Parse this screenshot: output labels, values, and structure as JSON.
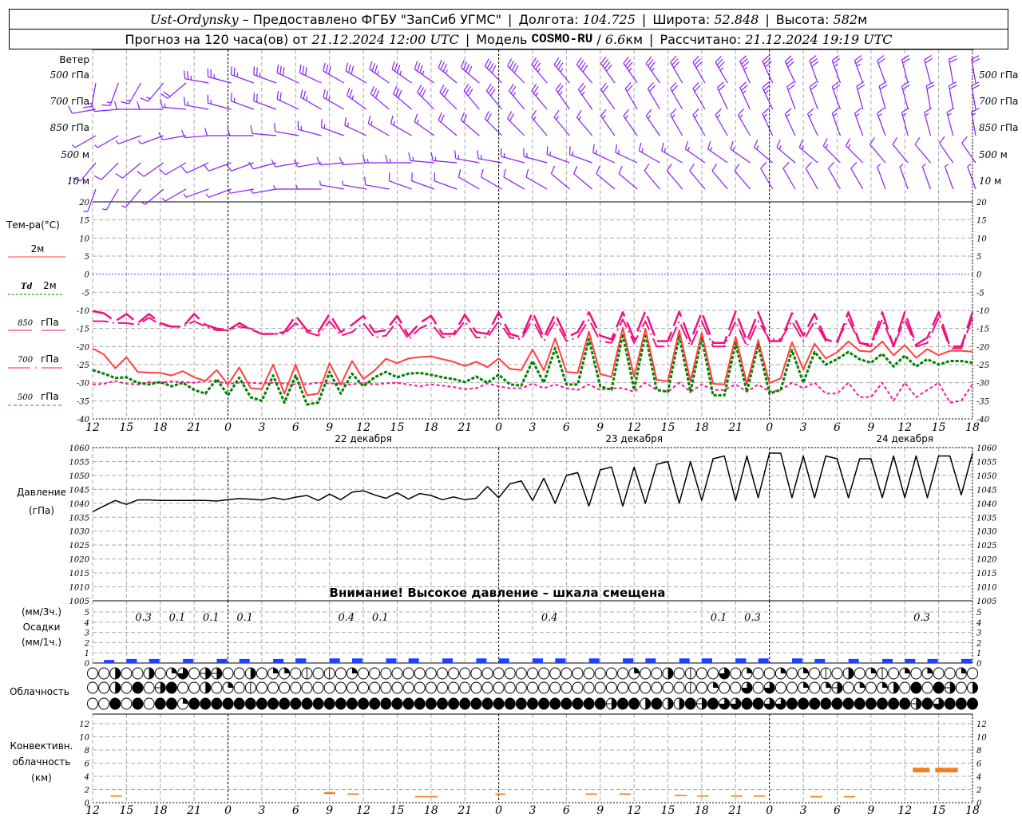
{
  "header": {
    "station": "Ust-Ordynsky",
    "provider": " – Предоставлено ФГБУ \"ЗапСиб УГМС\"",
    "sep": "|",
    "lon_label": "Долгота: ",
    "lon": "104.725",
    "lat_label": "Широта: ",
    "lat": "52.848",
    "alt_label": "Высота: ",
    "alt": "582",
    "alt_unit": "м",
    "forecast_label": "Прогноз на 120 часа(ов) от ",
    "forecast_start": "21.12.2024 12:00 UTC",
    "model_label": "Модель ",
    "model": "COSMO-RU",
    "model_sep": " / ",
    "resolution": "6.6",
    "resolution_unit": "км",
    "computed_label": "Рассчитано: ",
    "computed": "21.12.2024 19:19 UTC"
  },
  "colors": {
    "wind": "#8a1cf0",
    "t2m": "#ff4040",
    "td2m": "#008000",
    "t850": "#f0107f",
    "t700": "#f0107f",
    "t500": "#ff1493",
    "zero_line": "#3050ff",
    "precip": "#2040ff",
    "convective": "#f08020"
  },
  "x_axis": {
    "hour_labels": [
      "12",
      "15",
      "18",
      "21",
      "0",
      "3",
      "6",
      "9",
      "12",
      "15",
      "18",
      "21",
      "0",
      "3",
      "6",
      "9",
      "12",
      "15",
      "18",
      "21",
      "0",
      "3",
      "6",
      "9",
      "12",
      "15",
      "18"
    ],
    "dates": [
      "22 декабря",
      "23 декабря",
      "24 декабря"
    ]
  },
  "wind": {
    "title": "Ветер",
    "levels": [
      {
        "num": "500",
        "unit": " гПа",
        "dir": [
          190,
          200,
          210,
          220,
          230,
          280,
          285,
          290,
          290,
          295,
          295,
          300,
          300,
          305,
          305,
          305,
          310,
          310,
          315,
          315,
          320,
          320,
          320,
          325,
          325,
          325,
          330,
          330,
          330,
          335,
          335,
          335,
          340,
          340,
          340,
          340,
          345,
          345,
          350,
          350
        ],
        "speed": [
          15,
          15,
          15,
          15,
          20,
          25,
          25,
          25,
          25,
          30,
          30,
          30,
          30,
          35,
          35,
          35,
          35,
          40,
          40,
          40,
          35,
          35,
          40,
          40,
          35,
          35,
          30,
          30,
          35,
          35,
          30,
          30,
          30,
          25,
          25,
          20,
          20,
          20,
          20,
          20
        ]
      },
      {
        "num": "700",
        "unit": " гПа",
        "dir": [
          260,
          265,
          270,
          270,
          275,
          280,
          285,
          290,
          290,
          295,
          300,
          300,
          305,
          310,
          310,
          315,
          315,
          320,
          320,
          320,
          320,
          325,
          325,
          325,
          330,
          330,
          330,
          330,
          335,
          335,
          335,
          340,
          340,
          340,
          345,
          345,
          345,
          350,
          350,
          350
        ],
        "speed": [
          10,
          10,
          10,
          10,
          15,
          15,
          15,
          15,
          20,
          20,
          25,
          25,
          25,
          30,
          30,
          30,
          30,
          30,
          30,
          25,
          25,
          25,
          25,
          20,
          20,
          20,
          20,
          20,
          20,
          25,
          25,
          20,
          20,
          20,
          20,
          20,
          20,
          20,
          20,
          20
        ]
      },
      {
        "num": "850",
        "unit": " гПа",
        "dir": [
          240,
          240,
          250,
          250,
          260,
          265,
          270,
          270,
          275,
          280,
          285,
          290,
          295,
          300,
          300,
          305,
          310,
          310,
          315,
          315,
          320,
          320,
          320,
          325,
          325,
          325,
          330,
          330,
          330,
          330,
          335,
          335,
          335,
          340,
          340,
          340,
          345,
          345,
          345,
          350
        ],
        "speed": [
          5,
          5,
          5,
          5,
          10,
          10,
          10,
          10,
          10,
          10,
          15,
          15,
          15,
          15,
          15,
          15,
          20,
          20,
          20,
          20,
          15,
          15,
          15,
          15,
          15,
          15,
          15,
          15,
          15,
          15,
          15,
          15,
          15,
          15,
          15,
          15,
          15,
          15,
          15,
          15
        ]
      },
      {
        "num": "500",
        "unit": " м",
        "dir": [
          220,
          225,
          230,
          235,
          240,
          245,
          250,
          250,
          255,
          260,
          260,
          265,
          265,
          270,
          270,
          275,
          275,
          280,
          280,
          285,
          285,
          290,
          290,
          295,
          295,
          300,
          300,
          305,
          305,
          305,
          310,
          310,
          310,
          315,
          315,
          320,
          320,
          320,
          325,
          325
        ],
        "speed": [
          10,
          10,
          10,
          10,
          10,
          10,
          10,
          10,
          10,
          10,
          10,
          10,
          10,
          15,
          15,
          15,
          15,
          15,
          15,
          15,
          15,
          15,
          15,
          15,
          15,
          15,
          15,
          15,
          15,
          15,
          15,
          15,
          15,
          15,
          15,
          10,
          10,
          10,
          10,
          10
        ]
      },
      {
        "num": "10",
        "unit": "  м",
        "dir": [
          200,
          210,
          220,
          230,
          240,
          250,
          250,
          260,
          260,
          270,
          270,
          280,
          280,
          280,
          290,
          290,
          290,
          300,
          300,
          300,
          300,
          310,
          310,
          310,
          310,
          320,
          320,
          320,
          320,
          320,
          330,
          330,
          330,
          330,
          330,
          340,
          340,
          340,
          340,
          340
        ],
        "speed": [
          5,
          5,
          5,
          5,
          5,
          5,
          5,
          5,
          5,
          5,
          5,
          5,
          5,
          10,
          10,
          10,
          10,
          10,
          10,
          10,
          10,
          10,
          10,
          10,
          10,
          10,
          10,
          10,
          10,
          10,
          10,
          10,
          10,
          10,
          10,
          5,
          5,
          5,
          5,
          5
        ]
      }
    ]
  },
  "temperature": {
    "title": "Тем-ра(°С)",
    "legend": {
      "t2m": "2м",
      "td_symbol": "Td",
      "td_level": "2м",
      "l850_num": "850",
      "l700_num": "700",
      "l500_num": "500",
      "unit": "гПа"
    },
    "ticks": [
      20,
      15,
      10,
      5,
      0,
      -5,
      -10,
      -15,
      -20,
      -25,
      -30,
      -35,
      -40
    ]
  },
  "pressure": {
    "title": "Давление",
    "unit": "(гПа)",
    "ticks": [
      1060,
      1055,
      1050,
      1045,
      1040,
      1035,
      1030,
      1025,
      1020,
      1015,
      1010,
      1005
    ],
    "warning": "Внимание! Высокое давление – шкала смещена"
  },
  "precip": {
    "unit3h": "(мм/3ч.)",
    "title": "Осадки",
    "unit1h": "(мм/1ч.)",
    "ticks": [
      5,
      4,
      3,
      2,
      1,
      0
    ],
    "hourly": [
      [
        1.5,
        0.3
      ],
      [
        3.5,
        0.4
      ],
      [
        5.5,
        0.4
      ],
      [
        8.5,
        0.4
      ],
      [
        11.5,
        0.4
      ],
      [
        13.5,
        0.4
      ],
      [
        16.5,
        0.4
      ],
      [
        18.5,
        0.45
      ],
      [
        21.5,
        0.45
      ],
      [
        23.5,
        0.45
      ],
      [
        26.5,
        0.45
      ],
      [
        28.5,
        0.45
      ],
      [
        31.5,
        0.45
      ],
      [
        34.5,
        0.45
      ],
      [
        36.5,
        0.45
      ],
      [
        39.5,
        0.45
      ],
      [
        41.5,
        0.45
      ],
      [
        44.5,
        0.45
      ],
      [
        47.5,
        0.45
      ],
      [
        49.5,
        0.45
      ],
      [
        52.5,
        0.45
      ],
      [
        54.5,
        0.45
      ],
      [
        57.5,
        0.45
      ],
      [
        59.5,
        0.45
      ],
      [
        62.5,
        0.45
      ],
      [
        64.5,
        0.4
      ],
      [
        67.5,
        0.4
      ],
      [
        70.5,
        0.4
      ],
      [
        72.5,
        0.4
      ],
      [
        74.5,
        0.4
      ],
      [
        77.5,
        0.4
      ]
    ],
    "totals_3h": [
      [
        "0.3",
        4.5
      ],
      [
        "0.1",
        7.5
      ],
      [
        "0.1",
        10.5
      ],
      [
        "0.1",
        13.5
      ],
      [
        "0.4",
        22.5
      ],
      [
        "0.1",
        25.5
      ],
      [
        "0.4",
        40.5
      ],
      [
        "0.1",
        55.5
      ],
      [
        "0.3",
        58.5
      ],
      [
        "0.3",
        73.5
      ]
    ]
  },
  "clouds": {
    "title": "Облачность",
    "rows": [
      "0040040260550040220101020000000000000000000000002004010060200202010402102020020161",
      "0040805800402010000000000000000000000000000000000000010200606002025020240808504",
      "0080808828888888888888888888888888888888888888588484485866886688888888888586888"
    ]
  },
  "convective": {
    "title1": "Конвективн.",
    "title2": "облачность",
    "unit": "(км)",
    "ticks": [
      12,
      10,
      8,
      6,
      4,
      2,
      0
    ],
    "segments": [
      [
        1.6,
        2.6,
        0.9,
        1.1
      ],
      [
        20.5,
        21.5,
        1.3,
        1.6
      ],
      [
        22.6,
        23.6,
        1.2,
        1.4
      ],
      [
        28.6,
        30.6,
        0.8,
        1.0
      ],
      [
        35.7,
        36.6,
        1.2,
        1.4
      ],
      [
        43.7,
        44.7,
        1.2,
        1.4
      ],
      [
        46.7,
        47.7,
        1.2,
        1.4
      ],
      [
        51.6,
        52.7,
        1.0,
        1.2
      ],
      [
        53.6,
        54.6,
        0.9,
        1.1
      ],
      [
        56.6,
        57.6,
        0.9,
        1.1
      ],
      [
        58.6,
        59.6,
        0.9,
        1.1
      ],
      [
        63.6,
        64.7,
        0.8,
        1.0
      ],
      [
        66.6,
        67.6,
        0.8,
        1.0
      ],
      [
        72.7,
        74.2,
        4.6,
        5.3
      ],
      [
        74.7,
        76.7,
        4.6,
        5.3
      ]
    ]
  },
  "chart_data": {
    "type": "line",
    "x_unit": "hours from 21.12.2024 12:00 UTC",
    "temperature_series": {
      "t2m": [
        -20.5,
        -22.2,
        -26,
        -23,
        -27,
        -27.2,
        -27.3,
        -28,
        -26.8,
        -28.5,
        -29.5,
        -26.5,
        -30.5,
        -25.8,
        -31.5,
        -31.8,
        -25,
        -33,
        -25,
        -33.5,
        -33,
        -24.6,
        -30.5,
        -24,
        -29,
        -26.6,
        -23.4,
        -24.6,
        -23.3,
        -22.9,
        -22.7,
        -23.5,
        -24.2,
        -25.4,
        -24.2,
        -25.7,
        -23.3,
        -26.2,
        -26.5,
        -20.8,
        -26.6,
        -17.7,
        -27,
        -27.3,
        -15.9,
        -27.6,
        -28.4,
        -14.8,
        -28.4,
        -15.1,
        -29.2,
        -29.6,
        -15.5,
        -29.6,
        -16.2,
        -30.3,
        -30.5,
        -17.3,
        -30.3,
        -18.2,
        -30.1,
        -28.8,
        -18.8,
        -26.4,
        -19.2,
        -23.3,
        -21.6,
        -18.6,
        -21.2,
        -21.4,
        -18.6,
        -22.4,
        -19.6,
        -23.1,
        -20.7,
        -22.4,
        -21.2,
        -21.2,
        -21.4
      ],
      "td2m": [
        -26.5,
        -27.5,
        -28.7,
        -28.5,
        -30,
        -30.5,
        -29.8,
        -31,
        -30,
        -32,
        -33,
        -29,
        -33.5,
        -28.6,
        -34,
        -35,
        -28,
        -35.5,
        -28,
        -36,
        -35.5,
        -27,
        -33,
        -27.5,
        -31,
        -28.5,
        -27,
        -28.5,
        -27.5,
        -27.3,
        -27.8,
        -28.5,
        -29,
        -29.8,
        -28.3,
        -30,
        -27.8,
        -30.5,
        -30.8,
        -24,
        -30,
        -20.5,
        -30.5,
        -30.5,
        -18,
        -31,
        -32,
        -16.5,
        -32,
        -16.5,
        -32,
        -32.5,
        -17,
        -32.5,
        -17.5,
        -33.5,
        -33.5,
        -19,
        -32.5,
        -19.5,
        -33,
        -32,
        -21,
        -30,
        -21.5,
        -25,
        -23.5,
        -21.5,
        -23.5,
        -24.5,
        -22,
        -25.5,
        -22.5,
        -25.5,
        -23.5,
        -25,
        -24,
        -24,
        -24.5
      ],
      "t850": [
        -10.2,
        -10.8,
        -13,
        -11,
        -13.5,
        -11,
        -13.5,
        -14.5,
        -14.5,
        -11,
        -14,
        -15,
        -15.5,
        -13.5,
        -15.2,
        -16.5,
        -16.5,
        -16,
        -11.5,
        -15.5,
        -16,
        -11,
        -16,
        -14,
        -11.5,
        -16,
        -15.5,
        -11.5,
        -17,
        -13.5,
        -11.5,
        -16.5,
        -16.5,
        -11.2,
        -16,
        -16.5,
        -10.5,
        -16.5,
        -17.5,
        -10.5,
        -17.5,
        -11,
        -17.5,
        -16,
        -10.5,
        -17,
        -18,
        -10.5,
        -18,
        -10.2,
        -18.5,
        -18.5,
        -10.3,
        -18.5,
        -10.5,
        -19,
        -19,
        -10.3,
        -18.5,
        -10.5,
        -18.5,
        -18.5,
        -10.8,
        -17,
        -11,
        -18,
        -19,
        -10.5,
        -19,
        -19.5,
        -10.5,
        -20,
        -10.5,
        -19.5,
        -17.5,
        -10.5,
        -20,
        -20,
        -10.5
      ],
      "t700": [
        -13,
        -13,
        -13.5,
        -13.5,
        -14,
        -12,
        -14,
        -14.5,
        -14.5,
        -13,
        -14.5,
        -15.5,
        -15.5,
        -14.5,
        -15,
        -16.5,
        -16.5,
        -16.5,
        -13.5,
        -16,
        -17,
        -13,
        -17,
        -16,
        -13.5,
        -17.5,
        -17,
        -13,
        -18,
        -15,
        -13.5,
        -17.5,
        -17,
        -13,
        -17.5,
        -17.5,
        -13,
        -17.5,
        -18,
        -12.5,
        -18.5,
        -13,
        -18.5,
        -17.5,
        -12.5,
        -18.5,
        -19,
        -12.5,
        -19,
        -13,
        -20,
        -20,
        -13,
        -20,
        -13,
        -20,
        -20,
        -13,
        -20,
        -13,
        -18,
        -18,
        -13,
        -18.5,
        -13,
        -18.5,
        -18.5,
        -12.5,
        -19,
        -20,
        -12.5,
        -20,
        -12.5,
        -20,
        -19,
        -12,
        -20.5,
        -20.5,
        -12
      ],
      "t500": [
        -30.5,
        -30.3,
        -29.5,
        -30.3,
        -30.5,
        -29.8,
        -30,
        -29.6,
        -29.8,
        -30,
        -29.5,
        -29.6,
        -30.3,
        -30,
        -30,
        -30.2,
        -30,
        -30.2,
        -30.5,
        -30.4,
        -30,
        -30.2,
        -30.3,
        -30.5,
        -30,
        -30.5,
        -30.2,
        -30,
        -30.5,
        -31,
        -30.5,
        -30.8,
        -31.2,
        -31.8,
        -31.5,
        -30.2,
        -31,
        -31.5,
        -31.5,
        -30.3,
        -31.5,
        -30.5,
        -31.5,
        -32,
        -30.5,
        -32,
        -31.5,
        -31.5,
        -32.5,
        -30,
        -32,
        -32.5,
        -30,
        -32.5,
        -30.5,
        -32,
        -32,
        -30.5,
        -32.5,
        -30.5,
        -32.5,
        -32,
        -30,
        -31.5,
        -30,
        -33,
        -33,
        -30,
        -34,
        -34,
        -30,
        -35,
        -30,
        -34,
        -32,
        -30,
        -35.5,
        -35,
        -30.5
      ]
    },
    "temperature_ylim": [
      -40,
      20
    ],
    "pressure_series": [
      1037,
      1039,
      1041,
      1039.6,
      1041.2,
      1041.2,
      1041,
      1041,
      1041,
      1041,
      1041,
      1040.8,
      1041.3,
      1041.7,
      1041.5,
      1041.2,
      1042,
      1041.3,
      1042.2,
      1042.8,
      1041,
      1043.3,
      1041.3,
      1044,
      1044.5,
      1043,
      1041.8,
      1043.8,
      1041.5,
      1043.5,
      1042.8,
      1041.3,
      1042.3,
      1041.3,
      1041.8,
      1046,
      1042,
      1047,
      1048,
      1041,
      1049,
      1040,
      1050,
      1051,
      1039,
      1052,
      1053,
      1039,
      1053,
      1040,
      1054,
      1055,
      1040,
      1055,
      1041,
      1056,
      1057,
      1041,
      1057,
      1042,
      1058,
      1058,
      1042,
      1057,
      1042,
      1057,
      1056,
      1042,
      1056,
      1056,
      1042,
      1057,
      1042,
      1057,
      1042,
      1057,
      1057,
      1043,
      1058
    ],
    "pressure_ylim": [
      1005,
      1060
    ],
    "precip_ylim": [
      0,
      5
    ],
    "convective_ylim": [
      0,
      13
    ],
    "grid": true
  }
}
